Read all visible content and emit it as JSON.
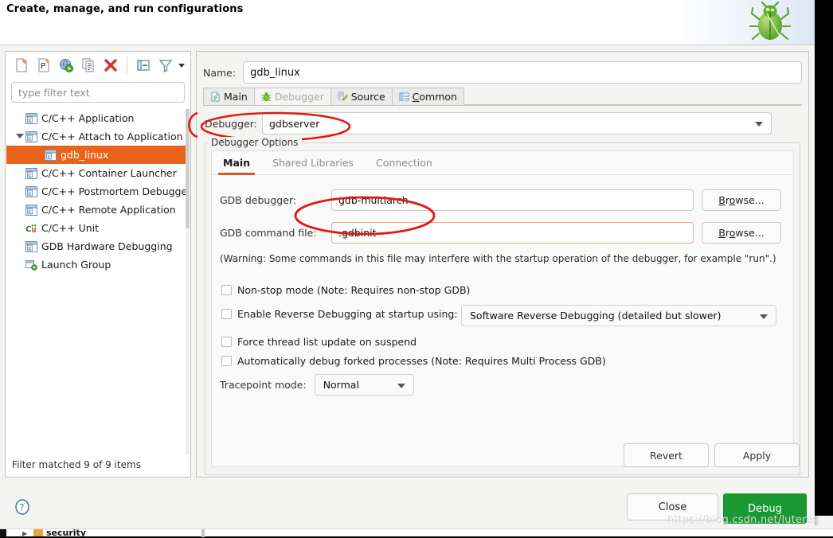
{
  "window": {
    "banner_title": "Create, manage, and run configurations",
    "bug_icon": "bug-icon"
  },
  "toolbar": {
    "icons": [
      {
        "name": "new-configuration-icon",
        "title": "New launch configuration"
      },
      {
        "name": "new-prototype-icon",
        "title": "New prototype"
      },
      {
        "name": "new-launch-group-icon",
        "title": "New launch group"
      },
      {
        "name": "duplicate-icon",
        "title": "Duplicate"
      },
      {
        "name": "delete-icon",
        "title": "Delete"
      },
      {
        "name": "collapse-all-icon",
        "title": "Collapse All"
      },
      {
        "name": "filter-icon",
        "title": "Filter"
      },
      {
        "name": "view-menu-icon",
        "title": "View Menu"
      }
    ]
  },
  "filter": {
    "placeholder": "type filter text",
    "value": "",
    "status": "Filter matched 9 of 9 items"
  },
  "tree": {
    "items": [
      {
        "label": "C/C++ Application",
        "icon": "c-config-icon",
        "level": 0,
        "selected": false,
        "expandable": false
      },
      {
        "label": "C/C++ Attach to Application",
        "icon": "c-config-icon",
        "level": 0,
        "selected": false,
        "expandable": true,
        "expanded": true
      },
      {
        "label": "gdb_linux",
        "icon": "c-config-icon",
        "level": 1,
        "selected": true,
        "expandable": false
      },
      {
        "label": "C/C++ Container Launcher",
        "icon": "c-config-icon",
        "level": 0,
        "selected": false,
        "expandable": false
      },
      {
        "label": "C/C++ Postmortem Debugger",
        "icon": "c-config-icon",
        "level": 0,
        "selected": false,
        "expandable": false
      },
      {
        "label": "C/C++ Remote Application",
        "icon": "c-config-icon",
        "level": 0,
        "selected": false,
        "expandable": false
      },
      {
        "label": "C/C++ Unit",
        "icon": "cunit-icon",
        "level": 0,
        "selected": false,
        "expandable": false
      },
      {
        "label": "GDB Hardware Debugging",
        "icon": "c-config-icon",
        "level": 0,
        "selected": false,
        "expandable": false
      },
      {
        "label": "Launch Group",
        "icon": "launch-group-icon",
        "level": 0,
        "selected": false,
        "expandable": false
      }
    ]
  },
  "config": {
    "name_label": "Name:",
    "name_value": "gdb_linux"
  },
  "tabs": [
    {
      "label": "Main",
      "icon": "document-icon",
      "active": false,
      "mnemonic": ""
    },
    {
      "label": "Debugger",
      "icon": "bug-small-icon",
      "active": true,
      "mnemonic": ""
    },
    {
      "label": "Source",
      "icon": "source-icon",
      "active": false,
      "mnemonic": ""
    },
    {
      "label": "Common",
      "icon": "common-icon",
      "active": false,
      "mnemonic": "C"
    }
  ],
  "debugger": {
    "label": "Debugger:",
    "value": "gdbserver",
    "group_title": "Debugger Options",
    "inner_tabs": [
      {
        "label": "Main",
        "active": true
      },
      {
        "label": "Shared Libraries",
        "active": false
      },
      {
        "label": "Connection",
        "active": false
      }
    ],
    "gdb_debugger_label": "GDB debugger:",
    "gdb_debugger_value": "gdb-multiarch",
    "gdb_command_file_label": "GDB command file:",
    "gdb_command_file_value": ".gdbinit",
    "browse_label": "Browse...",
    "warning_text": "(Warning: Some commands in this file may interfere with the startup operation of the debugger, for example \"run\".)",
    "checkboxes": [
      {
        "label": "Non-stop mode (Note: Requires non-stop GDB)",
        "checked": false,
        "name": "non-stop-mode"
      },
      {
        "label": "Enable Reverse Debugging at startup using:",
        "checked": false,
        "name": "reverse-debugging"
      },
      {
        "label": "Force thread list update on suspend",
        "checked": false,
        "name": "force-thread-list-update"
      },
      {
        "label": "Automatically debug forked processes (Note: Requires Multi Process GDB)",
        "checked": false,
        "name": "auto-debug-forked"
      }
    ],
    "reverse_debug_value": "Software Reverse Debugging (detailed but slower)",
    "tracepoint_label": "Tracepoint mode:",
    "tracepoint_value": "Normal"
  },
  "buttons": {
    "revert": "Revert",
    "apply": "Apply",
    "close": "Close",
    "debug": "Debug"
  },
  "background": {
    "row_label": "security"
  },
  "watermark": "https://blog.csdn.net/luteresa",
  "colors": {
    "selection_orange": "#e8641c",
    "accent_underline": "#d1591f",
    "debug_green": "#1a9933",
    "annotation_red": "#e01b10",
    "focus_border": "#eaa882"
  }
}
